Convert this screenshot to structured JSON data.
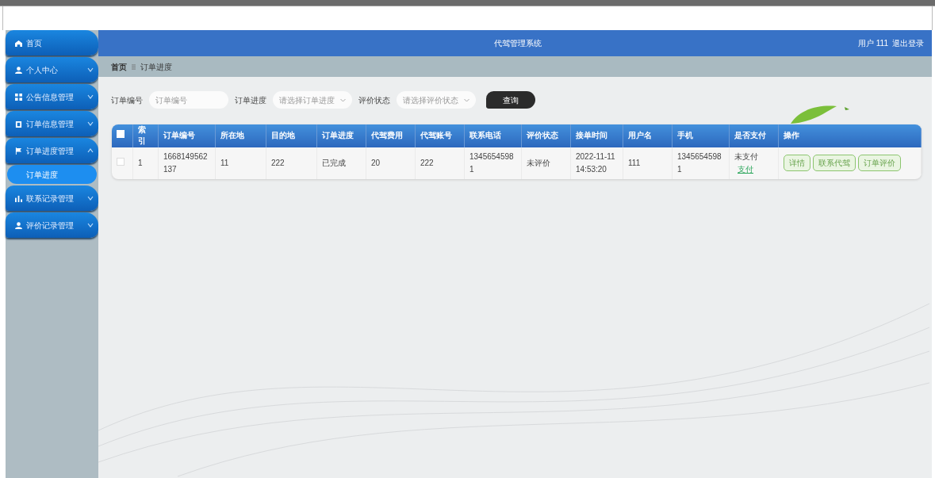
{
  "header": {
    "title": "代驾管理系统",
    "user": "用户 111",
    "logout": "退出登录"
  },
  "sidebar": {
    "items": [
      {
        "label": "首页"
      },
      {
        "label": "个人中心",
        "expanded": false
      },
      {
        "label": "公告信息管理",
        "expanded": false
      },
      {
        "label": "订单信息管理",
        "expanded": false
      },
      {
        "label": "订单进度管理",
        "expanded": true,
        "children": [
          {
            "label": "订单进度",
            "selected": true
          }
        ]
      },
      {
        "label": "联系记录管理",
        "expanded": false
      },
      {
        "label": "评价记录管理",
        "expanded": false
      }
    ]
  },
  "breadcrumb": [
    "首页",
    "订单进度"
  ],
  "search": {
    "fields": [
      {
        "label": "订单编号",
        "kind": "input",
        "placeholder": "订单编号"
      },
      {
        "label": "订单进度",
        "kind": "select",
        "placeholder": "请选择订单进度"
      },
      {
        "label": "评价状态",
        "kind": "select",
        "placeholder": "请选择评价状态"
      }
    ],
    "button": "查询"
  },
  "table": {
    "columns": [
      "索引",
      "订单编号",
      "所在地",
      "目的地",
      "订单进度",
      "代驾费用",
      "代驾账号",
      "联系电话",
      "评价状态",
      "接单时间",
      "用户名",
      "手机",
      "是否支付",
      "操作"
    ],
    "all_checked": false,
    "rows": [
      {
        "checked": false,
        "cells": [
          "1",
          "1668149562137",
          "11",
          "222",
          "已完成",
          "20",
          "222",
          "13456545981",
          "未评价",
          "2022-11-11 14:53:20",
          "111",
          "13456545981"
        ],
        "payment": "未支付",
        "pay_link": "支付",
        "actions": [
          "详情",
          "联系代驾",
          "订单评价"
        ]
      }
    ]
  }
}
